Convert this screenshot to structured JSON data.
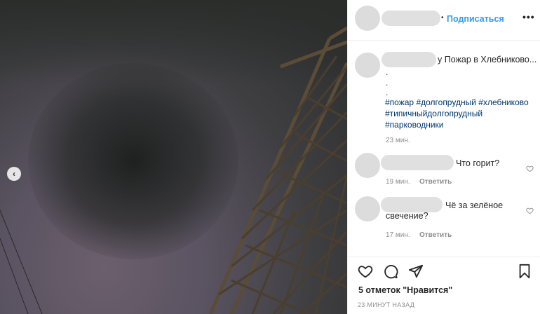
{
  "post": {
    "follow_label": "Подписаться",
    "more_label": "•••",
    "dot_sep": "•",
    "caption": "у Пожар в Хлебниково...",
    "caption_dots": [
      ".",
      ".",
      "."
    ],
    "hashtags": [
      "#пожар",
      "#долгопрудный",
      "#хлебниково",
      "#типичныйдолгопрудный",
      "#парководники"
    ],
    "caption_time": "23 мин."
  },
  "comments": [
    {
      "text": "Что горит?",
      "time": "19 мин.",
      "reply": "Ответить"
    },
    {
      "text": "Чё за зелёное свечение?",
      "time": "17 мин.",
      "reply": "Ответить"
    }
  ],
  "footer": {
    "likes": "5 отметок \"Нравится\"",
    "posted": "23 МИНУТ НАЗАД"
  },
  "icons": {
    "prev": "chevron-left-icon",
    "like": "heart-icon",
    "comment": "comment-icon",
    "share": "paper-plane-icon",
    "save": "bookmark-icon"
  },
  "colors": {
    "accent": "#3897f0",
    "hashtag": "#00376b",
    "muted": "#8e8e8e"
  }
}
